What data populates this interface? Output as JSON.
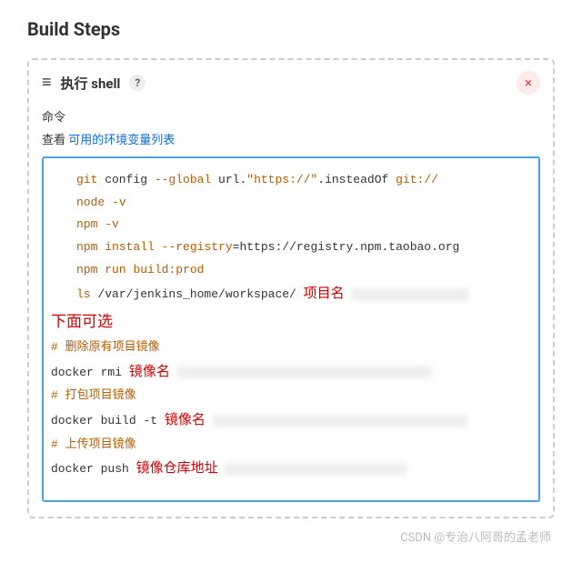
{
  "page_title": "Build Steps",
  "step": {
    "title": "执行 shell",
    "help": "?",
    "close": "×",
    "field_label": "命令",
    "see_prefix": "查看 ",
    "see_link": "可用的环境变量列表"
  },
  "code": {
    "l1_a": "git",
    "l1_b": " config ",
    "l1_c": "--global",
    "l1_d": " url.",
    "l1_e": "\"https://\"",
    "l1_f": ".insteadOf ",
    "l1_g": "git://",
    "l2_a": "node ",
    "l2_b": "-v",
    "l3_a": "npm ",
    "l3_b": "-v",
    "l4_a": "npm ",
    "l4_b": "install ",
    "l4_c": "--registry",
    "l4_d": "=https://registry.npm.taobao.org",
    "l5_a": "npm ",
    "l5_b": "run ",
    "l5_c": "build:prod",
    "l6_a": "ls ",
    "l6_b": "/var/jenkins_home/workspace/",
    "anno_project": "项目名",
    "anno_optional": "下面可选",
    "c1": "# 删除原有项目镜像",
    "l7": "docker rmi ",
    "anno_image1": "镜像名",
    "c2": "# 打包项目镜像",
    "l8": "docker build -t ",
    "anno_image2": "镜像名",
    "c3": "# 上传项目镜像",
    "l9": "docker push ",
    "anno_repo": "镜像仓库地址"
  },
  "watermark": "CSDN @专治八阿哥的孟老师"
}
